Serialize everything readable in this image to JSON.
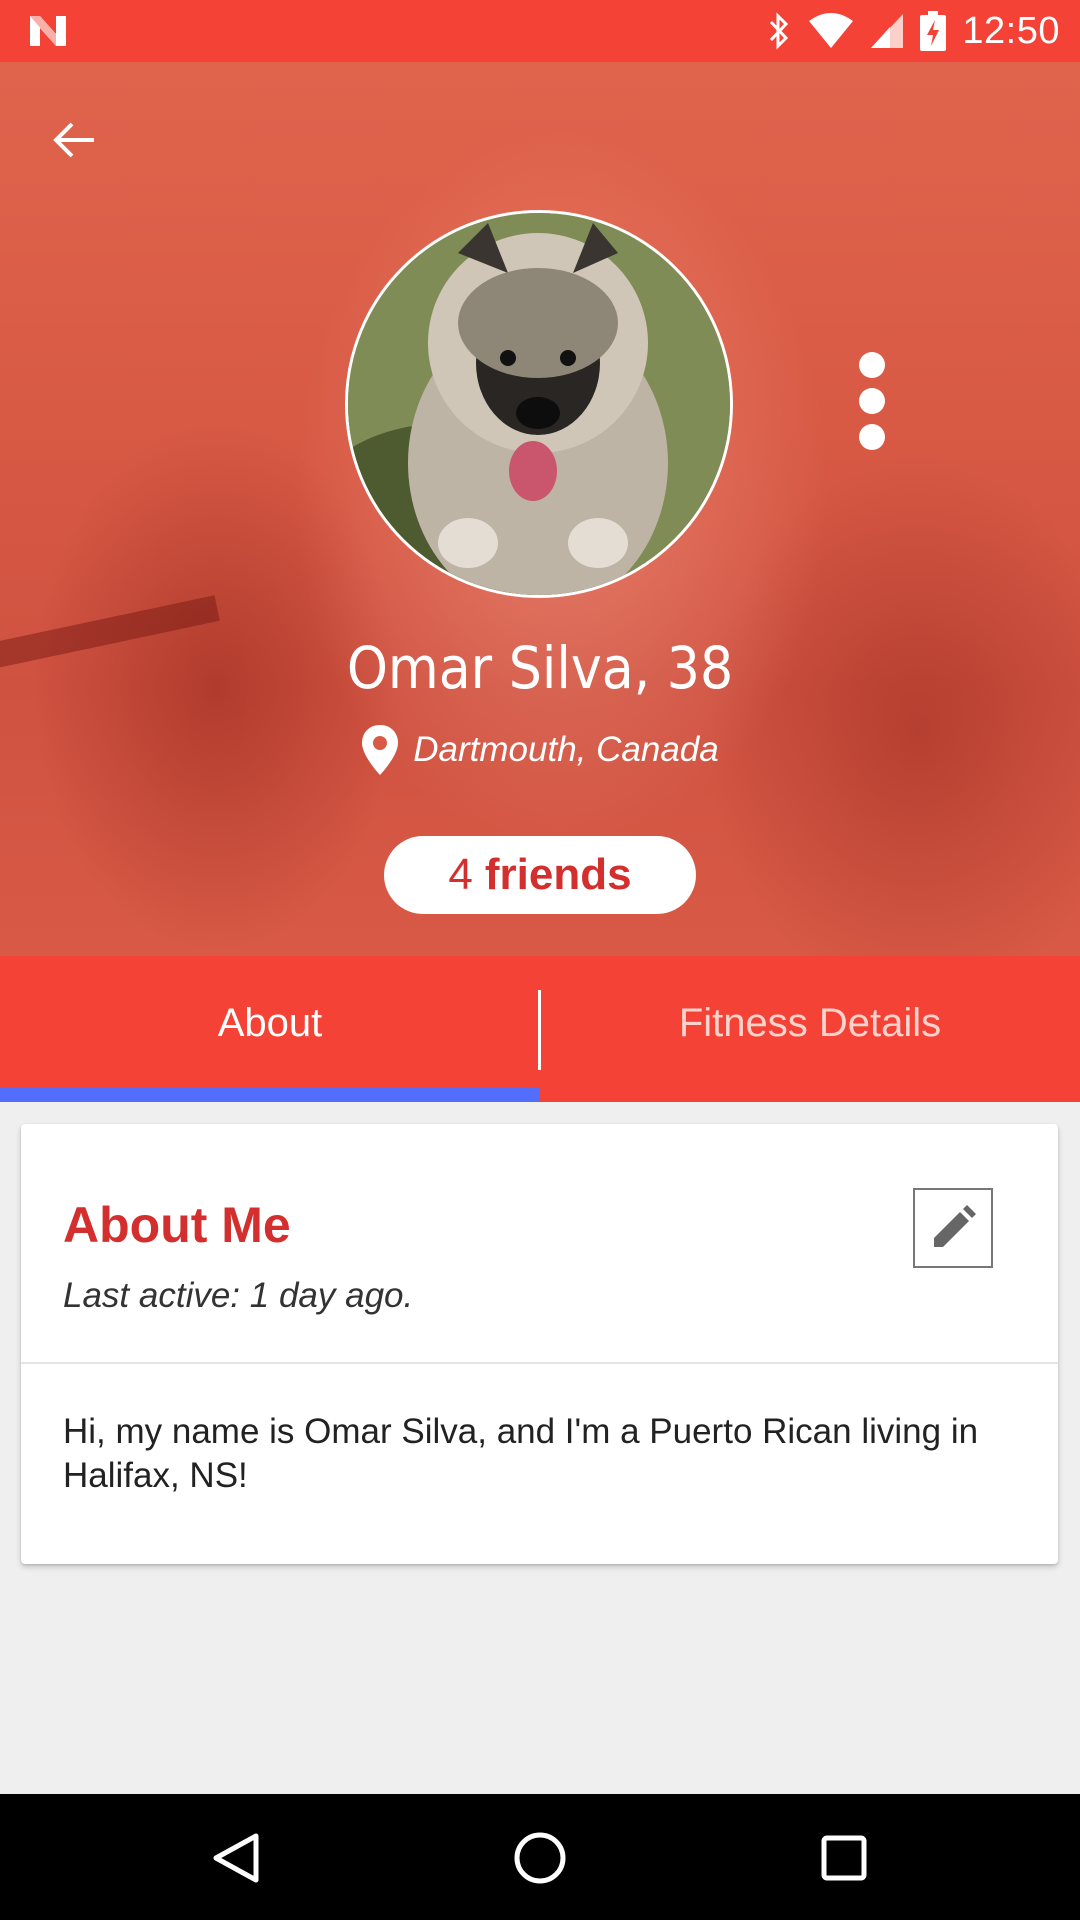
{
  "status_bar": {
    "time": "12:50",
    "icons": [
      "n-logo-icon",
      "bluetooth-icon",
      "wifi-icon",
      "signal-icon",
      "battery-charging-icon"
    ]
  },
  "header": {
    "back_icon": "arrow-back-icon",
    "more_icon": "more-vert-icon",
    "name": "Omar Silva, 38",
    "location": "Dartmouth, Canada",
    "location_icon": "location-pin-icon",
    "friends_count": "4",
    "friends_label": "friends"
  },
  "tabs": [
    {
      "label": "About",
      "active": true
    },
    {
      "label": "Fitness Details",
      "active": false
    }
  ],
  "about_card": {
    "title": "About Me",
    "last_active": "Last active: 1 day ago.",
    "edit_icon": "pencil-icon",
    "body": "Hi, my name is Omar Silva, and I'm a Puerto Rican living in Halifax, NS!"
  },
  "nav_bar": {
    "buttons": [
      "back-triangle-icon",
      "home-circle-icon",
      "recents-square-icon"
    ]
  },
  "colors": {
    "primary": "#f44336",
    "accent": "#536dfe",
    "title_red": "#d32f2f",
    "background": "#efefef"
  }
}
